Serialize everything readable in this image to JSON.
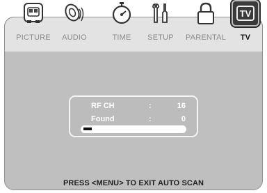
{
  "menu": {
    "tabs": [
      {
        "label": "PICTURE",
        "icon": "picture-icon",
        "active": false
      },
      {
        "label": "AUDIO",
        "icon": "audio-icon",
        "active": false
      },
      {
        "label": "TIME",
        "icon": "timer-icon",
        "active": false
      },
      {
        "label": "SETUP",
        "icon": "tools-icon",
        "active": false
      },
      {
        "label": "PARENTAL",
        "icon": "lock-icon",
        "active": false
      },
      {
        "label": "TV",
        "icon": "tv-icon",
        "active": true
      }
    ],
    "tv_icon_text": "TV"
  },
  "scan": {
    "rf_ch_label": "RF CH",
    "rf_ch_sep": ":",
    "rf_ch_value": "16",
    "found_label": "Found",
    "found_sep": ":",
    "found_value": "0",
    "progress": 0.08
  },
  "footer": {
    "hint": "PRESS <MENU> TO EXIT AUTO SCAN"
  },
  "colors": {
    "screen_bg": "#bfbfbf",
    "menu_bg": "#e3e3e3",
    "text_white": "#ffffff"
  }
}
